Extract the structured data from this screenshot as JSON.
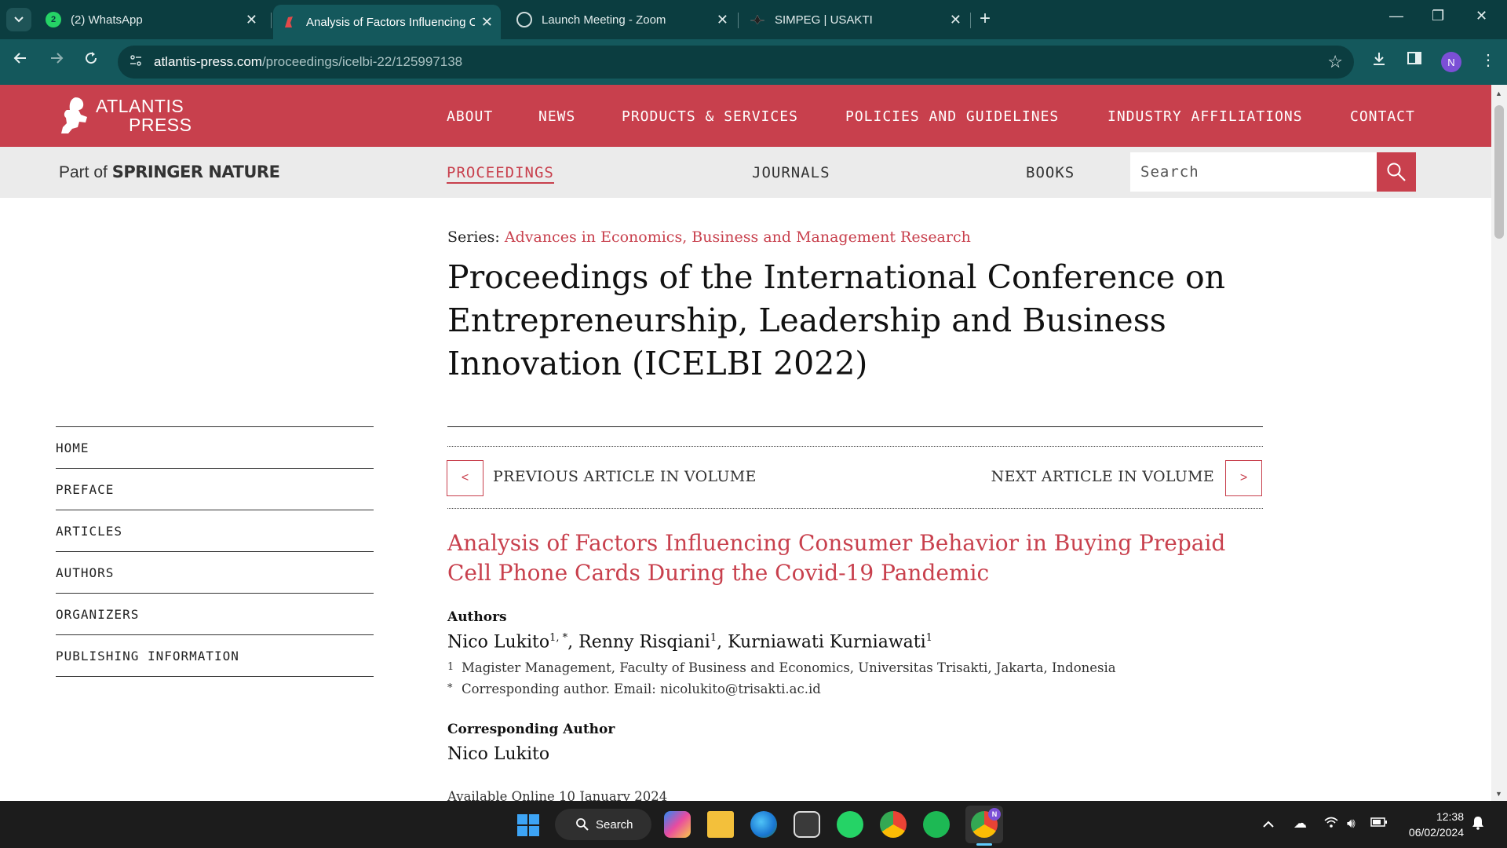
{
  "browser": {
    "tabs": [
      {
        "title": "(2) WhatsApp",
        "badge": "2",
        "active": false
      },
      {
        "title": "Analysis of Factors Influencing C",
        "active": true
      },
      {
        "title": "Launch Meeting - Zoom",
        "active": false
      },
      {
        "title": "SIMPEG | USAKTI",
        "active": false
      }
    ],
    "new_tab": "+",
    "url_domain": "atlantis-press.com",
    "url_path": "/proceedings/icelbi-22/125997138",
    "profile_initial": "N"
  },
  "site": {
    "logo_line1": "ATLANTIS",
    "logo_line2": "PRESS",
    "top_nav": [
      "ABOUT",
      "NEWS",
      "PRODUCTS & SERVICES",
      "POLICIES AND GUIDELINES",
      "INDUSTRY AFFILIATIONS",
      "CONTACT"
    ],
    "part_of": "Part of",
    "springer": "SPRINGER NATURE",
    "sub_nav": [
      "PROCEEDINGS",
      "JOURNALS",
      "BOOKS"
    ],
    "search_placeholder": "Search",
    "brand_color": "#c8404d"
  },
  "content": {
    "series_label": "Series:",
    "series_link": "Advances in Economics, Business and Management Research",
    "proceedings_title": "Proceedings of the International Conference on Entrepreneurship, Leadership and Business Innovation (ICELBI 2022)",
    "sidebar": [
      "HOME",
      "PREFACE",
      "ARTICLES",
      "AUTHORS",
      "ORGANIZERS",
      "PUBLISHING INFORMATION"
    ],
    "prev_arrow": "<",
    "prev_label": "PREVIOUS ARTICLE IN VOLUME",
    "next_label": "NEXT ARTICLE IN VOLUME",
    "next_arrow": ">",
    "article_title": "Analysis of Factors Influencing Consumer Behavior in Buying Prepaid Cell Phone Cards During the Covid-19 Pandemic",
    "authors_label": "Authors",
    "authors": [
      {
        "name": "Nico Lukito",
        "sup": "1, *",
        "sep": ", "
      },
      {
        "name": "Renny Risqiani",
        "sup": "1",
        "sep": ", "
      },
      {
        "name": "Kurniawati Kurniawati",
        "sup": "1",
        "sep": ""
      }
    ],
    "affiliation_marker": "1",
    "affiliation": "Magister Management, Faculty of Business and Economics, Universitas Trisakti, Jakarta, Indonesia",
    "corresponding_marker": "*",
    "corresponding_note": "Corresponding author. Email: nicolukito@trisakti.ac.id",
    "corresponding_label": "Corresponding Author",
    "corresponding_name": "Nico Lukito",
    "available_online": "Available Online 10 January 2024"
  },
  "taskbar": {
    "search_label": "Search",
    "time": "12:38",
    "date": "06/02/2024",
    "chrome_badge": "N"
  }
}
